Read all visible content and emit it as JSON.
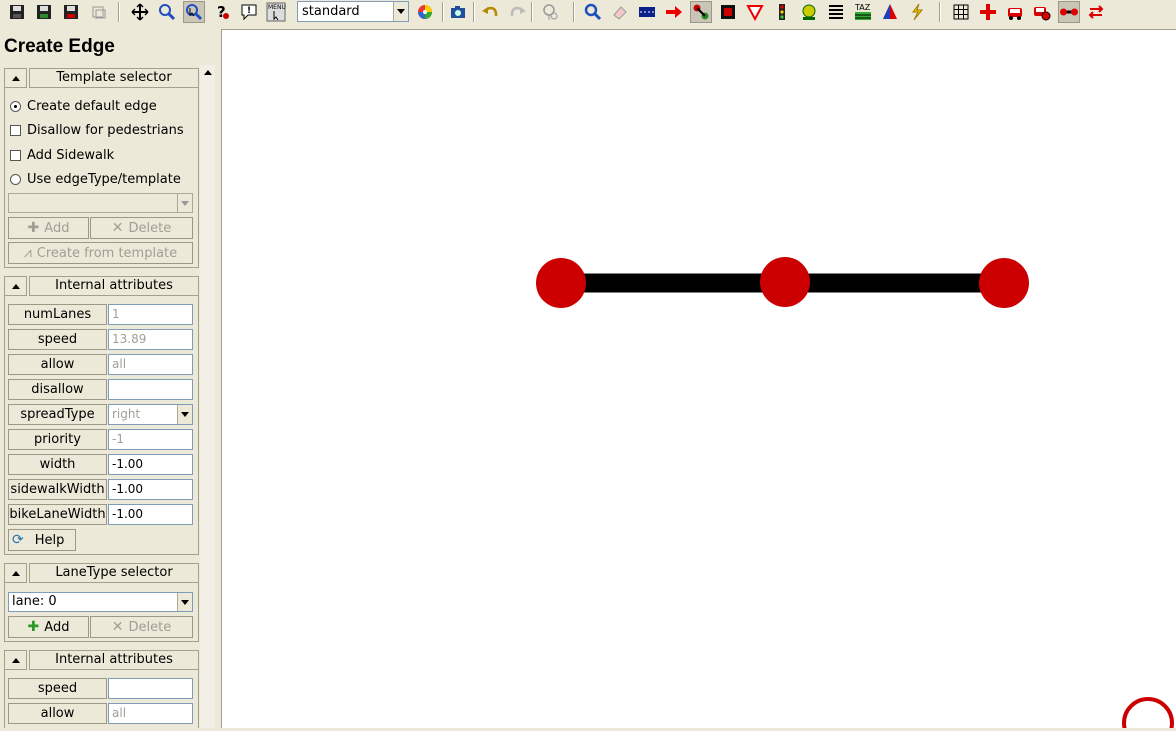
{
  "toolbar": {
    "scheme_value": "standard",
    "menu_icon_label": "MENU",
    "taz_icon_label": "TAZ",
    "icons": [
      "save-icon",
      "save-as-icon",
      "save-network-icon",
      "reload-icon",
      "inspect-mode-icon",
      "locate-icon",
      "select-mode-icon",
      "help-icon",
      "notes-icon",
      "menu-icon",
      "color-wheel-icon",
      "screenshot-icon",
      "undo-icon",
      "redo-icon",
      "additional-icon",
      "search-icon",
      "eraser-icon",
      "lane-icon",
      "arrow-icon",
      "connection-icon",
      "crossing-icon",
      "prohibition-icon",
      "traffic-light-icon",
      "edge-data-icon",
      "list-icon",
      "taz-icon",
      "poly-icon",
      "wire-icon",
      "grid-icon",
      "add-icon",
      "vehicle-icon",
      "vehicle-type-icon",
      "edge-mode-icon",
      "swap-icon"
    ]
  },
  "frame": {
    "title": "Create Edge",
    "template_selector": {
      "title": "Template selector",
      "options": [
        {
          "label": "Create default edge",
          "type": "radio",
          "checked": true
        },
        {
          "label": "Disallow for pedestrians",
          "type": "check",
          "checked": false
        },
        {
          "label": "Add Sidewalk",
          "type": "check",
          "checked": false
        },
        {
          "label": "Use edgeType/template",
          "type": "radio",
          "checked": false
        }
      ],
      "combo_value": "",
      "add_label": "Add",
      "delete_label": "Delete",
      "create_label": "Create from template"
    },
    "internal_attributes": {
      "title": "Internal attributes",
      "rows": [
        {
          "label": "numLanes",
          "value": "1",
          "grey": true
        },
        {
          "label": "speed",
          "value": "13.89",
          "grey": true
        },
        {
          "label": "allow",
          "value": "all",
          "grey": true
        },
        {
          "label": "disallow",
          "value": "",
          "grey": false
        },
        {
          "label": "spreadType",
          "value": "right",
          "grey": true
        },
        {
          "label": "priority",
          "value": "-1",
          "grey": true
        },
        {
          "label": "width",
          "value": "-1.00",
          "grey": false
        },
        {
          "label": "sidewalkWidth",
          "value": "-1.00",
          "grey": false
        },
        {
          "label": "bikeLaneWidth",
          "value": "-1.00",
          "grey": false
        }
      ],
      "help_label": "Help"
    },
    "lanetype_selector": {
      "title": "LaneType selector",
      "combo_value": "lane: 0",
      "add_label": "Add",
      "delete_label": "Delete"
    },
    "lane_internal_attributes": {
      "title": "Internal attributes",
      "rows": [
        {
          "label": "speed",
          "value": "",
          "grey": false
        },
        {
          "label": "allow",
          "value": "all",
          "grey": true
        }
      ]
    }
  },
  "network": {
    "edge_color": "#000000",
    "junction_color": "#cc0000",
    "junctions": [
      "junction-a",
      "junction-b",
      "junction-c"
    ]
  }
}
